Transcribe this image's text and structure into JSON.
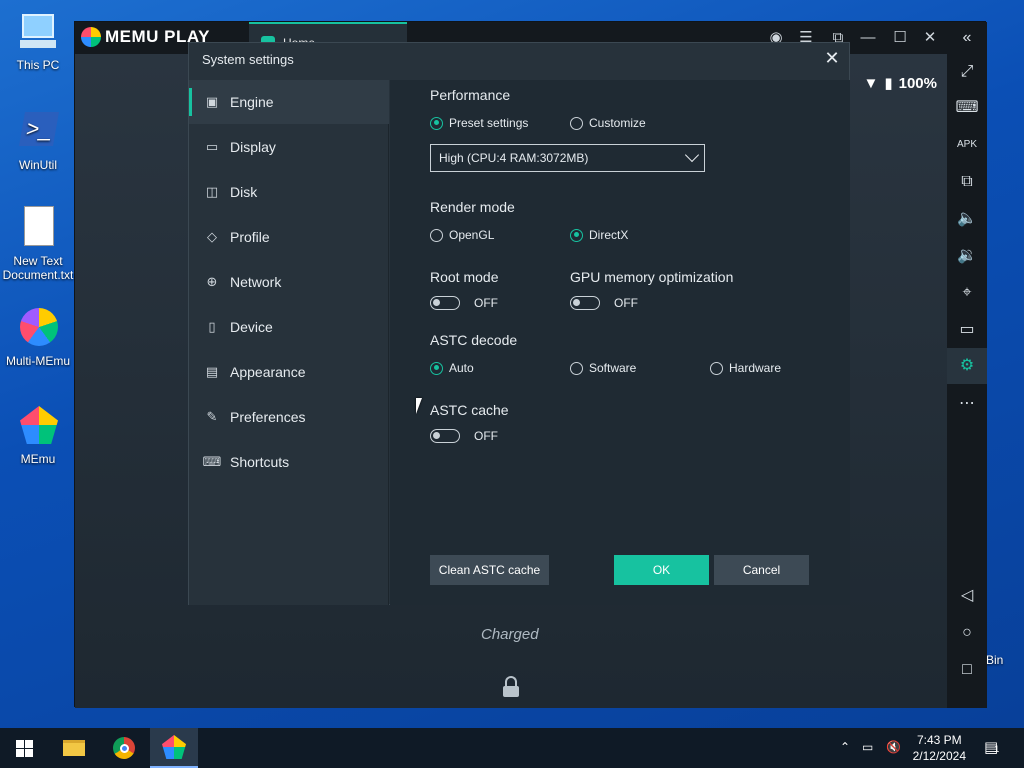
{
  "desktop": {
    "icons": [
      {
        "label": "This PC",
        "icon": "this-pc-icon"
      },
      {
        "label": "WinUtil",
        "icon": "powershell-shortcut-icon"
      },
      {
        "label": "New Text Document.txt",
        "icon": "text-document-icon"
      },
      {
        "label": "Multi-MEmu",
        "icon": "multi-memu-icon"
      },
      {
        "label": "MEmu",
        "icon": "memu-icon"
      }
    ],
    "bin_label": "Bin"
  },
  "emulator": {
    "logo_text": "MEMU PLAY",
    "tab_label": "Home",
    "titlebar_buttons": [
      "account-icon",
      "menu-icon",
      "screen-icon",
      "minimize-icon",
      "maximize-icon",
      "close-icon",
      "collapse-icon"
    ],
    "battery_text": "100%",
    "charged_text": "Charged",
    "toolbar": [
      "fullscreen-icon",
      "keyboard-icon",
      "apk-icon",
      "multi-window-icon",
      "volume-up-icon",
      "volume-down-icon",
      "location-icon",
      "folder-icon",
      "settings-icon",
      "more-icon",
      "back-icon",
      "home-icon",
      "recents-icon"
    ]
  },
  "dialog": {
    "title": "System settings",
    "close_glyph": "✕",
    "nav": [
      {
        "label": "Engine",
        "icon": "chip-icon",
        "glyph": "▣"
      },
      {
        "label": "Display",
        "icon": "monitor-icon",
        "glyph": "▭"
      },
      {
        "label": "Disk",
        "icon": "disk-icon",
        "glyph": "◫"
      },
      {
        "label": "Profile",
        "icon": "tag-icon",
        "glyph": "◇"
      },
      {
        "label": "Network",
        "icon": "globe-icon",
        "glyph": "⊕"
      },
      {
        "label": "Device",
        "icon": "phone-icon",
        "glyph": "▯"
      },
      {
        "label": "Appearance",
        "icon": "appearance-icon",
        "glyph": "▤"
      },
      {
        "label": "Preferences",
        "icon": "wrench-icon",
        "glyph": "✎"
      },
      {
        "label": "Shortcuts",
        "icon": "keyboard-icon",
        "glyph": "⌨"
      }
    ],
    "performance": {
      "title": "Performance",
      "preset_label": "Preset settings",
      "customize_label": "Customize",
      "select_value": "High (CPU:4 RAM:3072MB)"
    },
    "render_mode": {
      "title": "Render mode",
      "opengl_label": "OpenGL",
      "directx_label": "DirectX"
    },
    "root_mode": {
      "title": "Root mode",
      "state": "OFF"
    },
    "gpu_memory": {
      "title": "GPU memory optimization",
      "state": "OFF"
    },
    "astc_decode": {
      "title": "ASTC decode",
      "auto_label": "Auto",
      "software_label": "Software",
      "hardware_label": "Hardware"
    },
    "astc_cache": {
      "title": "ASTC cache",
      "state": "OFF"
    },
    "buttons": {
      "clean": "Clean ASTC cache",
      "ok": "OK",
      "cancel": "Cancel"
    }
  },
  "taskbar": {
    "time": "7:43 PM",
    "date": "2/12/2024",
    "notification_count": "1"
  }
}
